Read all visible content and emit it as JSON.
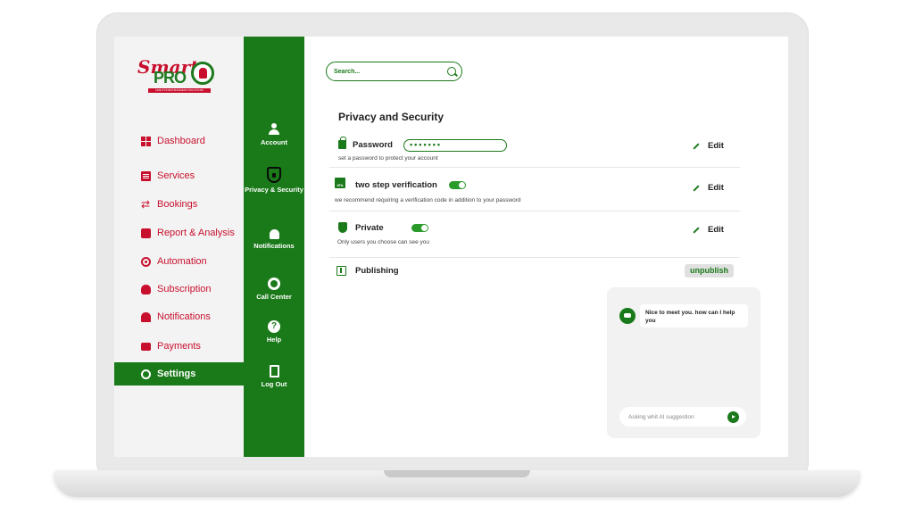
{
  "brand": {
    "logo_word1": "Smart",
    "logo_word2": "PRO",
    "tagline": "ONE SYSTEM BUSINESS SOLUTIONS"
  },
  "sidebar": {
    "items": [
      {
        "label": "Dashboard",
        "icon": "grid-icon"
      },
      {
        "label": "Services",
        "icon": "document-icon"
      },
      {
        "label": "Bookings",
        "icon": "swap-icon"
      },
      {
        "label": "Report & Analysis",
        "icon": "report-icon"
      },
      {
        "label": "Automation",
        "icon": "gear-icon"
      },
      {
        "label": "Subscription",
        "icon": "money-bag-icon"
      },
      {
        "label": "Notifications",
        "icon": "bell-icon"
      },
      {
        "label": "Payments",
        "icon": "card-icon"
      },
      {
        "label": "Settings",
        "icon": "settings-icon",
        "active": true
      }
    ]
  },
  "settings_nav": {
    "items": [
      {
        "label": "Account",
        "icon": "user-icon"
      },
      {
        "label": "Privacy & Security",
        "icon": "shield-icon",
        "active": true
      },
      {
        "label": "Notifications",
        "icon": "bell-icon"
      },
      {
        "label": "Call Center",
        "icon": "headset-icon"
      },
      {
        "label": "Help",
        "icon": "help-icon"
      },
      {
        "label": "Log Out",
        "icon": "logout-icon"
      }
    ]
  },
  "search": {
    "placeholder": "Search..."
  },
  "page": {
    "title": "Privacy and Security"
  },
  "settings": {
    "password": {
      "label": "Password",
      "value": "•••••••",
      "description": "set a password to protect your account",
      "edit_label": "Edit"
    },
    "two_step": {
      "label": "two step verification",
      "badge": "2FA",
      "enabled": true,
      "description": "we recommend requiring a verification code in addition to your password",
      "edit_label": "Edit"
    },
    "private": {
      "label": "Private",
      "enabled": true,
      "description": "Only users you choose can see you",
      "edit_label": "Edit"
    },
    "publishing": {
      "label": "Publishing",
      "action_label": "unpublish"
    }
  },
  "chat": {
    "message": "Nice to meet you. how can I help you",
    "input_placeholder": "Asking whit AI suggestion"
  },
  "colors": {
    "primary_green": "#1a7a1a",
    "accent_red": "#c8102e",
    "sidebar_bg": "#f3f3f3"
  }
}
